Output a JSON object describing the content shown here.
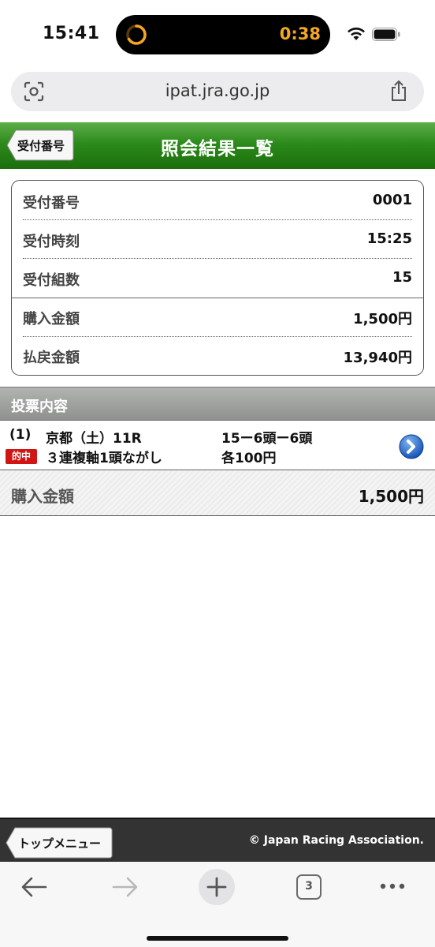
{
  "status_bar": {
    "time": "15:41",
    "timer": "0:38",
    "icons": [
      "timer-icon",
      "wifi-icon",
      "battery-icon"
    ]
  },
  "browser": {
    "url": "ipat.jra.go.jp",
    "tabs_count": "3"
  },
  "header": {
    "back_label": "受付番号",
    "title": "照会結果一覧",
    "accent_color": "#2c8a1b"
  },
  "summary": {
    "rows": [
      {
        "label": "受付番号",
        "value": "0001"
      },
      {
        "label": "受付時刻",
        "value": "15:25"
      },
      {
        "label": "受付組数",
        "value": "15"
      },
      {
        "label": "購入金額",
        "value": "1,500円"
      },
      {
        "label": "払戻金額",
        "value": "13,940円"
      }
    ]
  },
  "section": {
    "title": "投票内容"
  },
  "bet": {
    "number": "(1)",
    "race": "京都（土）11R",
    "combination": "15ー6頭ー6頭",
    "hit_badge": "的中",
    "bet_type": "３連複軸1頭ながし",
    "amount_each": "各100円",
    "hit_color": "#d01515"
  },
  "total": {
    "label": "購入金額",
    "value": "1,500円"
  },
  "footer": {
    "top_menu_label": "トップメニュー",
    "copyright": "© Japan Racing Association."
  }
}
